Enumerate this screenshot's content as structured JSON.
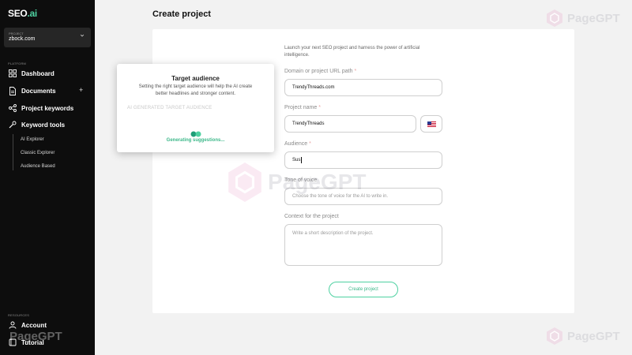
{
  "sidebar": {
    "logo_main": "SEO",
    "logo_suffix": ".ai",
    "project": {
      "label": "PROJECT",
      "value": "zbock.com"
    },
    "platform_label": "PLATFORM",
    "items": [
      {
        "label": "Dashboard",
        "icon": "dashboard-icon"
      },
      {
        "label": "Documents",
        "icon": "document-icon"
      },
      {
        "label": "Project keywords",
        "icon": "share-icon"
      },
      {
        "label": "Keyword tools",
        "icon": "wrench-icon"
      }
    ],
    "sub_items": [
      "AI Explorer",
      "Classic Explorer",
      "Audience Based"
    ],
    "resources_label": "RESOURCES",
    "resources": [
      {
        "label": "Account",
        "icon": "user-icon"
      },
      {
        "label": "Tutorial",
        "icon": "book-icon"
      }
    ]
  },
  "main": {
    "title": "Create project",
    "intro": "Launch your next SEO project and harness the power of artificial intelligence.",
    "fields": {
      "domain": {
        "label": "Domain or project URL path",
        "value": "TrendyThreads.com"
      },
      "name": {
        "label": "Project name",
        "value": "TrendyThreads"
      },
      "audience": {
        "label": "Audience",
        "value": "Sus"
      },
      "tone": {
        "label": "Tone of voice",
        "placeholder": "Choose the tone of voice for the AI to write in."
      },
      "context": {
        "label": "Context for the project",
        "placeholder": "Write a short description of the project."
      }
    },
    "required_mark": "*",
    "create_label": "Create project"
  },
  "popup": {
    "title": "Target audience",
    "description": "Setting the right target audience will help the AI create better headlines and stronger content.",
    "section_label": "AI GENERATED TARGET AUDIENCE",
    "status": "Generating suggestions..."
  },
  "watermark": "PageGPT",
  "colors": {
    "accent": "#4ed1a1",
    "sidebar": "#0d0d0d"
  }
}
